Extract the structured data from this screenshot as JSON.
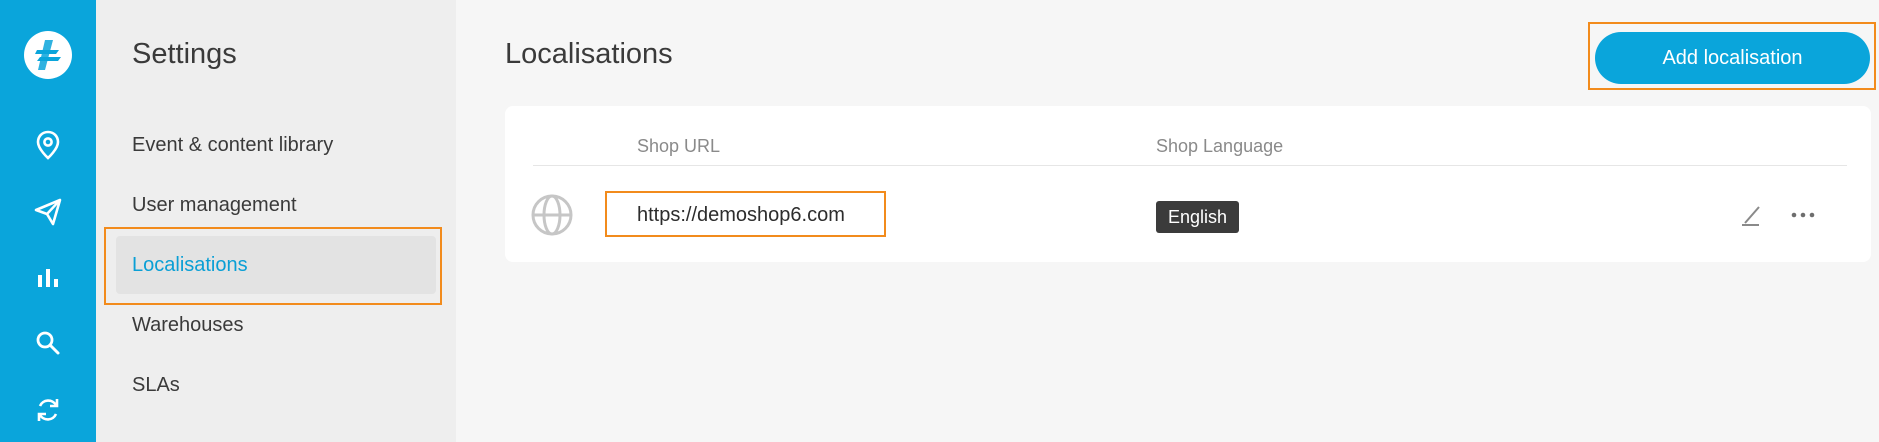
{
  "colors": {
    "accent": "#0aa5db",
    "highlight": "#f28b1c",
    "badge": "#3b3b3b"
  },
  "rail": {
    "logo": "brand-logo",
    "icons": [
      "location-pin-icon",
      "paper-plane-icon",
      "bar-chart-icon",
      "search-icon",
      "refresh-icon"
    ]
  },
  "settings": {
    "title": "Settings",
    "items": [
      {
        "label": "Event & content library",
        "active": false
      },
      {
        "label": "User management",
        "active": false
      },
      {
        "label": "Localisations",
        "active": true
      },
      {
        "label": "Warehouses",
        "active": false
      },
      {
        "label": "SLAs",
        "active": false
      }
    ]
  },
  "main": {
    "title": "Localisations",
    "add_button_label": "Add localisation",
    "table": {
      "columns": [
        "Shop URL",
        "Shop Language"
      ],
      "rows": [
        {
          "icon": "globe-icon",
          "shop_url": "https://demoshop6.com",
          "shop_language": "English"
        }
      ]
    }
  }
}
